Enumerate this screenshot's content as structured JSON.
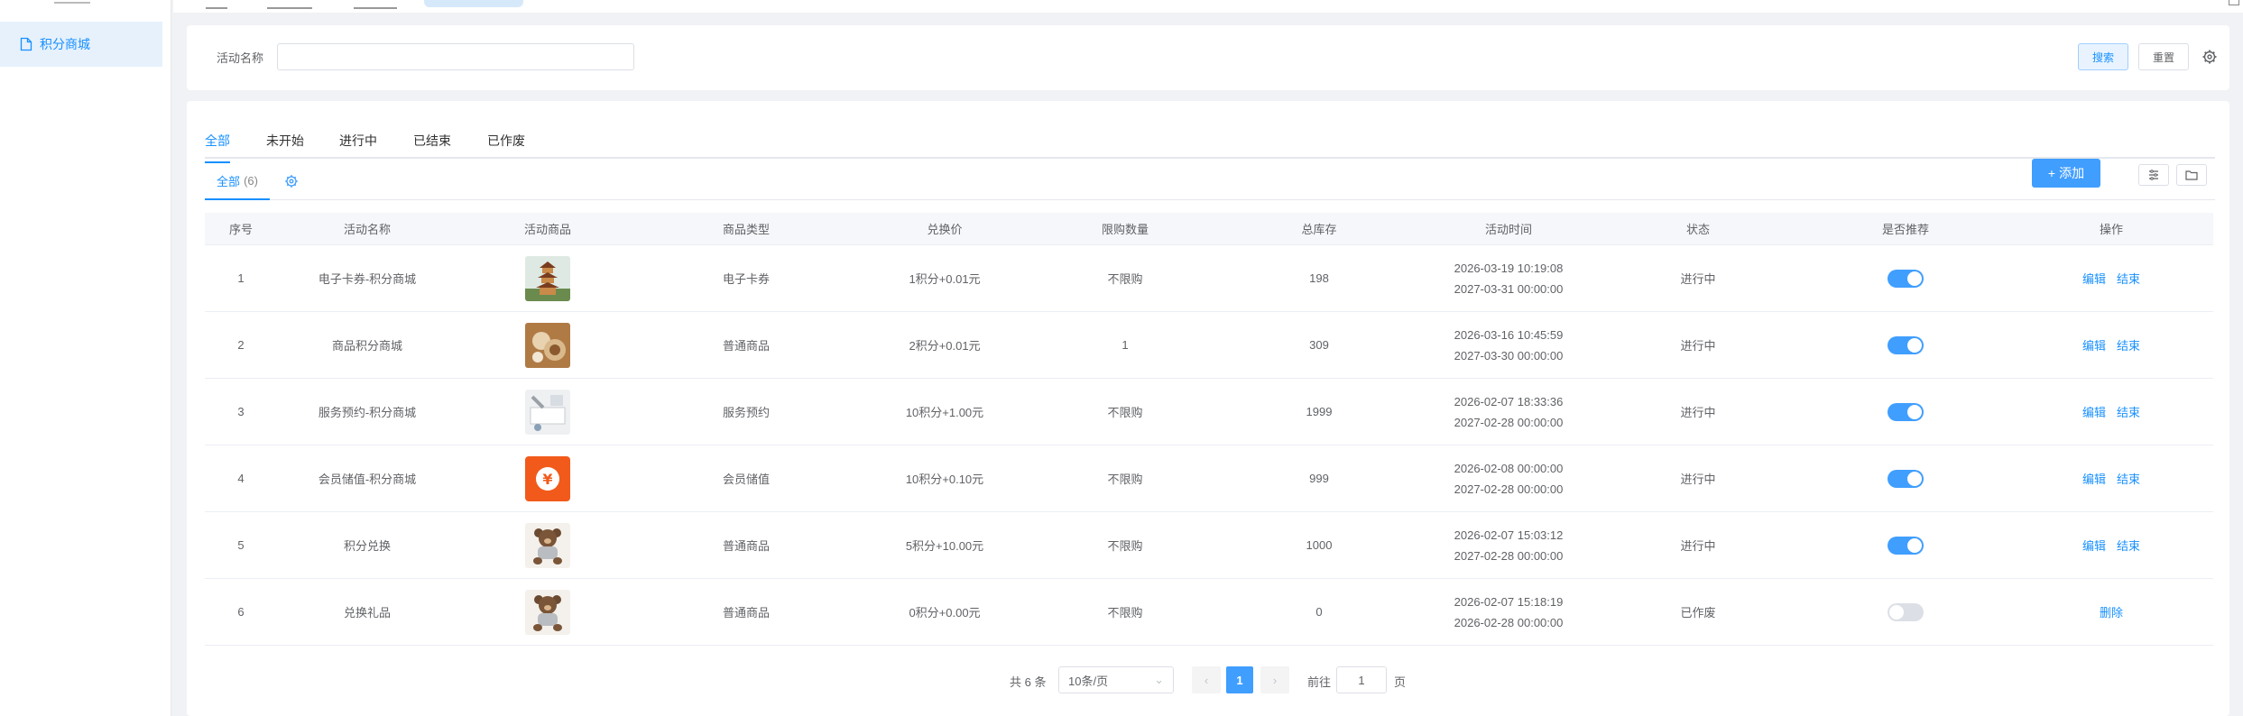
{
  "sidebar": {
    "items": [
      {
        "label": "积分商城"
      }
    ]
  },
  "search": {
    "label": "活动名称",
    "value": "",
    "placeholder": "",
    "search_button": "搜索",
    "reset_button": "重置"
  },
  "status_tabs": [
    "全部",
    "未开始",
    "进行中",
    "已结束",
    "已作废"
  ],
  "sub_tab": {
    "label": "全部",
    "count": "(6)"
  },
  "toolbar": {
    "add_label": "添加"
  },
  "table": {
    "columns": [
      "序号",
      "活动名称",
      "活动商品",
      "商品类型",
      "兑换价",
      "限购数量",
      "总库存",
      "活动时间",
      "状态",
      "是否推荐",
      "操作"
    ],
    "rows": [
      {
        "index": "1",
        "name": "电子卡券-积分商城",
        "thumb": "pagoda",
        "type": "电子卡券",
        "price": "1积分+0.01元",
        "limit": "不限购",
        "stock": "198",
        "start": "2026-03-19 10:19:08",
        "end": "2027-03-31 00:00:00",
        "status": "进行中",
        "recommend": true,
        "actions": [
          "编辑",
          "结束"
        ]
      },
      {
        "index": "2",
        "name": "商品积分商城",
        "thumb": "food",
        "type": "普通商品",
        "price": "2积分+0.01元",
        "limit": "1",
        "stock": "309",
        "start": "2026-03-16 10:45:59",
        "end": "2027-03-30 00:00:00",
        "status": "进行中",
        "recommend": true,
        "actions": [
          "编辑",
          "结束"
        ]
      },
      {
        "index": "3",
        "name": "服务预约-积分商城",
        "thumb": "service",
        "type": "服务预约",
        "price": "10积分+1.00元",
        "limit": "不限购",
        "stock": "1999",
        "start": "2026-02-07 18:33:36",
        "end": "2027-02-28 00:00:00",
        "status": "进行中",
        "recommend": true,
        "actions": [
          "编辑",
          "结束"
        ]
      },
      {
        "index": "4",
        "name": "会员储值-积分商城",
        "thumb": "yuan",
        "type": "会员储值",
        "price": "10积分+0.10元",
        "limit": "不限购",
        "stock": "999",
        "start": "2026-02-08 00:00:00",
        "end": "2027-02-28 00:00:00",
        "status": "进行中",
        "recommend": true,
        "actions": [
          "编辑",
          "结束"
        ]
      },
      {
        "index": "5",
        "name": "积分兑换",
        "thumb": "bear",
        "type": "普通商品",
        "price": "5积分+10.00元",
        "limit": "不限购",
        "stock": "1000",
        "start": "2026-02-07 15:03:12",
        "end": "2027-02-28 00:00:00",
        "status": "进行中",
        "recommend": true,
        "actions": [
          "编辑",
          "结束"
        ]
      },
      {
        "index": "6",
        "name": "兑换礼品",
        "thumb": "bear",
        "type": "普通商品",
        "price": "0积分+0.00元",
        "limit": "不限购",
        "stock": "0",
        "start": "2026-02-07 15:18:19",
        "end": "2026-02-28 00:00:00",
        "status": "已作废",
        "recommend": false,
        "actions": [
          "删除"
        ]
      }
    ]
  },
  "pagination": {
    "total": "共 6 条",
    "page_size": "10条/页",
    "current": "1",
    "goto_label": "前往",
    "goto_value": "1",
    "goto_unit": "页"
  },
  "colors": {
    "accent": "#409eff",
    "sidebar_active_bg": "#e6f1fc"
  }
}
